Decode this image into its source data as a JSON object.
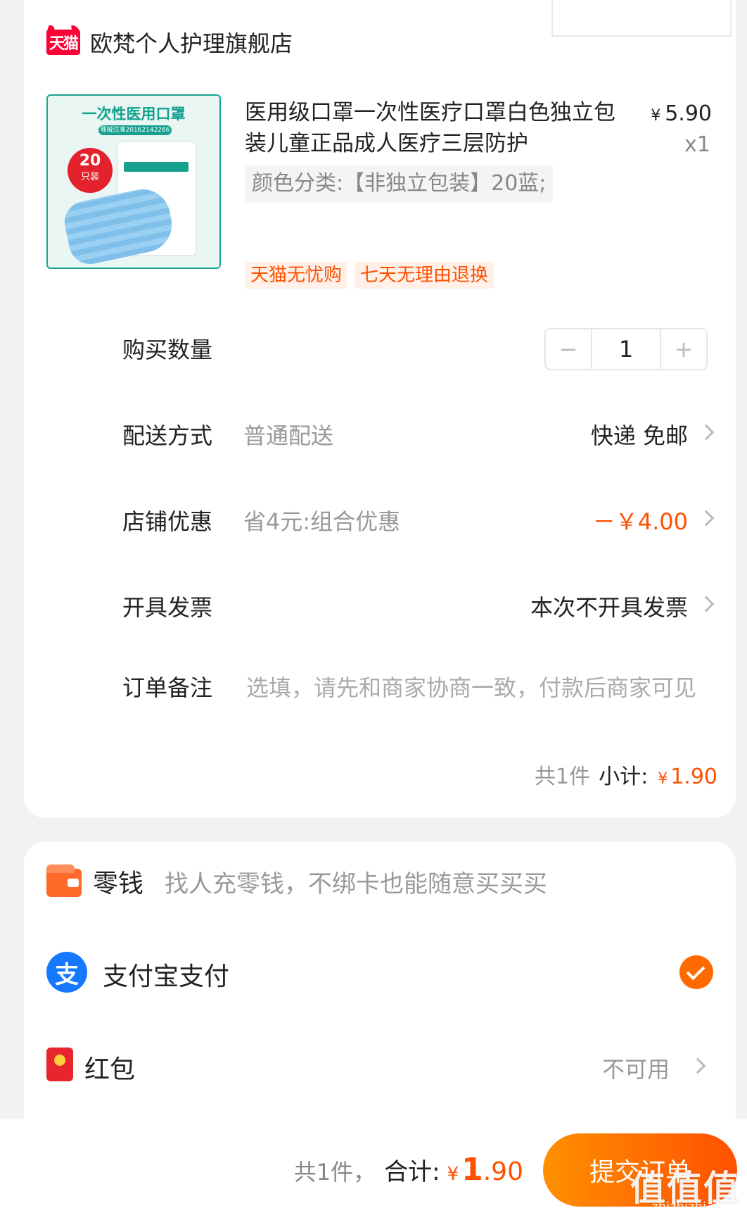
{
  "store": {
    "logo_text": "天猫",
    "name": "欧梵个人护理旗舰店"
  },
  "product": {
    "image": {
      "title": "一次性医用口罩",
      "subtitle": "鄂械注准20162142266",
      "badge_num": "20",
      "badge_text": "只装"
    },
    "title": "医用级口罩一次性医疗口罩白色独立包装儿童正品成人医疗三层防护",
    "price_symbol": "¥",
    "price": "5.90",
    "qty": "x1",
    "spec": "颜色分类:【非独立包装】20蓝;",
    "tags": [
      "天猫无忧购",
      "七天无理由退换"
    ]
  },
  "quantity": {
    "label": "购买数量",
    "value": "1",
    "minus": "−",
    "plus": "+"
  },
  "delivery": {
    "label": "配送方式",
    "sub": "普通配送",
    "value": "快递 免邮"
  },
  "shop_discount": {
    "label": "店铺优惠",
    "sub": "省4元:组合优惠",
    "value": "－￥4.00"
  },
  "invoice": {
    "label": "开具发票",
    "value": "本次不开具发票"
  },
  "note": {
    "label": "订单备注",
    "placeholder": "选填，请先和商家协商一致，付款后商家可见"
  },
  "subtotal": {
    "count": "共1件",
    "label": "小计:",
    "symbol": "¥",
    "amount": "1.90"
  },
  "payment": {
    "change": {
      "label": "零钱",
      "hint": "找人充零钱，不绑卡也能随意买买买"
    },
    "alipay": {
      "icon_text": "支",
      "label": "支付宝支付",
      "selected": true
    },
    "redpacket": {
      "label": "红包",
      "value": "不可用"
    }
  },
  "footer": {
    "count": "共1件，",
    "total_label": "合计:",
    "symbol": "¥",
    "amount_int": "1",
    "amount_dec": ".90",
    "submit": "提交订单",
    "watermark": "值值值",
    "watermark_sub": "zhizhizhi.com"
  },
  "colors": {
    "accent": "#ff5000",
    "tmall": "#ff0036",
    "alipay": "#1677ff"
  }
}
